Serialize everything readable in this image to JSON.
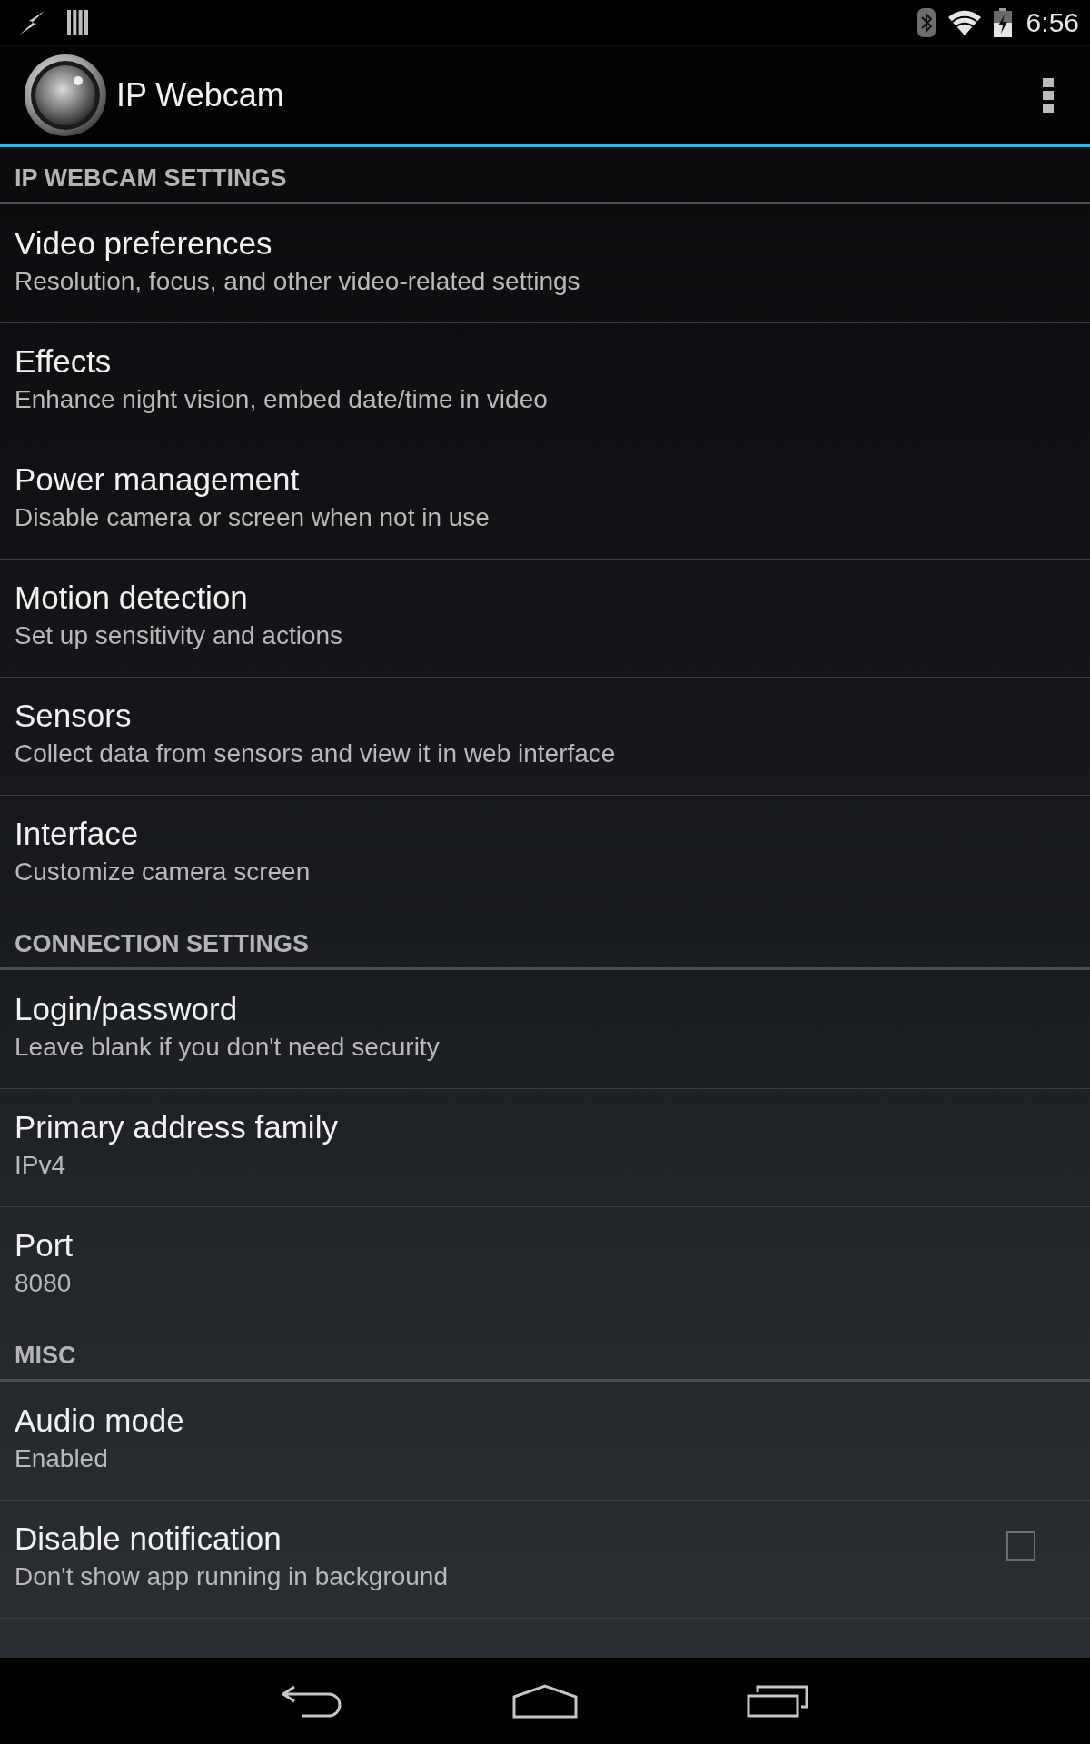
{
  "status_bar": {
    "time": "6:56"
  },
  "app_bar": {
    "title": "IP Webcam"
  },
  "sections": [
    {
      "header": "IP WEBCAM SETTINGS",
      "items": [
        {
          "kind": "plain",
          "title": "Video preferences",
          "summary": "Resolution, focus, and other video-related settings"
        },
        {
          "kind": "plain",
          "title": "Effects",
          "summary": "Enhance night vision, embed date/time in video"
        },
        {
          "kind": "plain",
          "title": "Power management",
          "summary": "Disable camera or screen when not in use"
        },
        {
          "kind": "plain",
          "title": "Motion detection",
          "summary": "Set up sensitivity and actions"
        },
        {
          "kind": "plain",
          "title": "Sensors",
          "summary": "Collect data from sensors and view it in web interface"
        },
        {
          "kind": "plain",
          "title": "Interface",
          "summary": "Customize camera screen"
        }
      ]
    },
    {
      "header": "CONNECTION SETTINGS",
      "items": [
        {
          "kind": "plain",
          "title": "Login/password",
          "summary": "Leave blank if you don't need security"
        },
        {
          "kind": "plain",
          "title": "Primary address family",
          "summary": "IPv4"
        },
        {
          "kind": "plain",
          "title": "Port",
          "summary": "8080"
        }
      ]
    },
    {
      "header": "MISC",
      "items": [
        {
          "kind": "plain",
          "title": "Audio mode",
          "summary": "Enabled"
        },
        {
          "kind": "checkbox",
          "title": "Disable notification",
          "summary": "Don't show app running in background",
          "checked": false
        },
        {
          "kind": "plain"
        }
      ]
    }
  ]
}
